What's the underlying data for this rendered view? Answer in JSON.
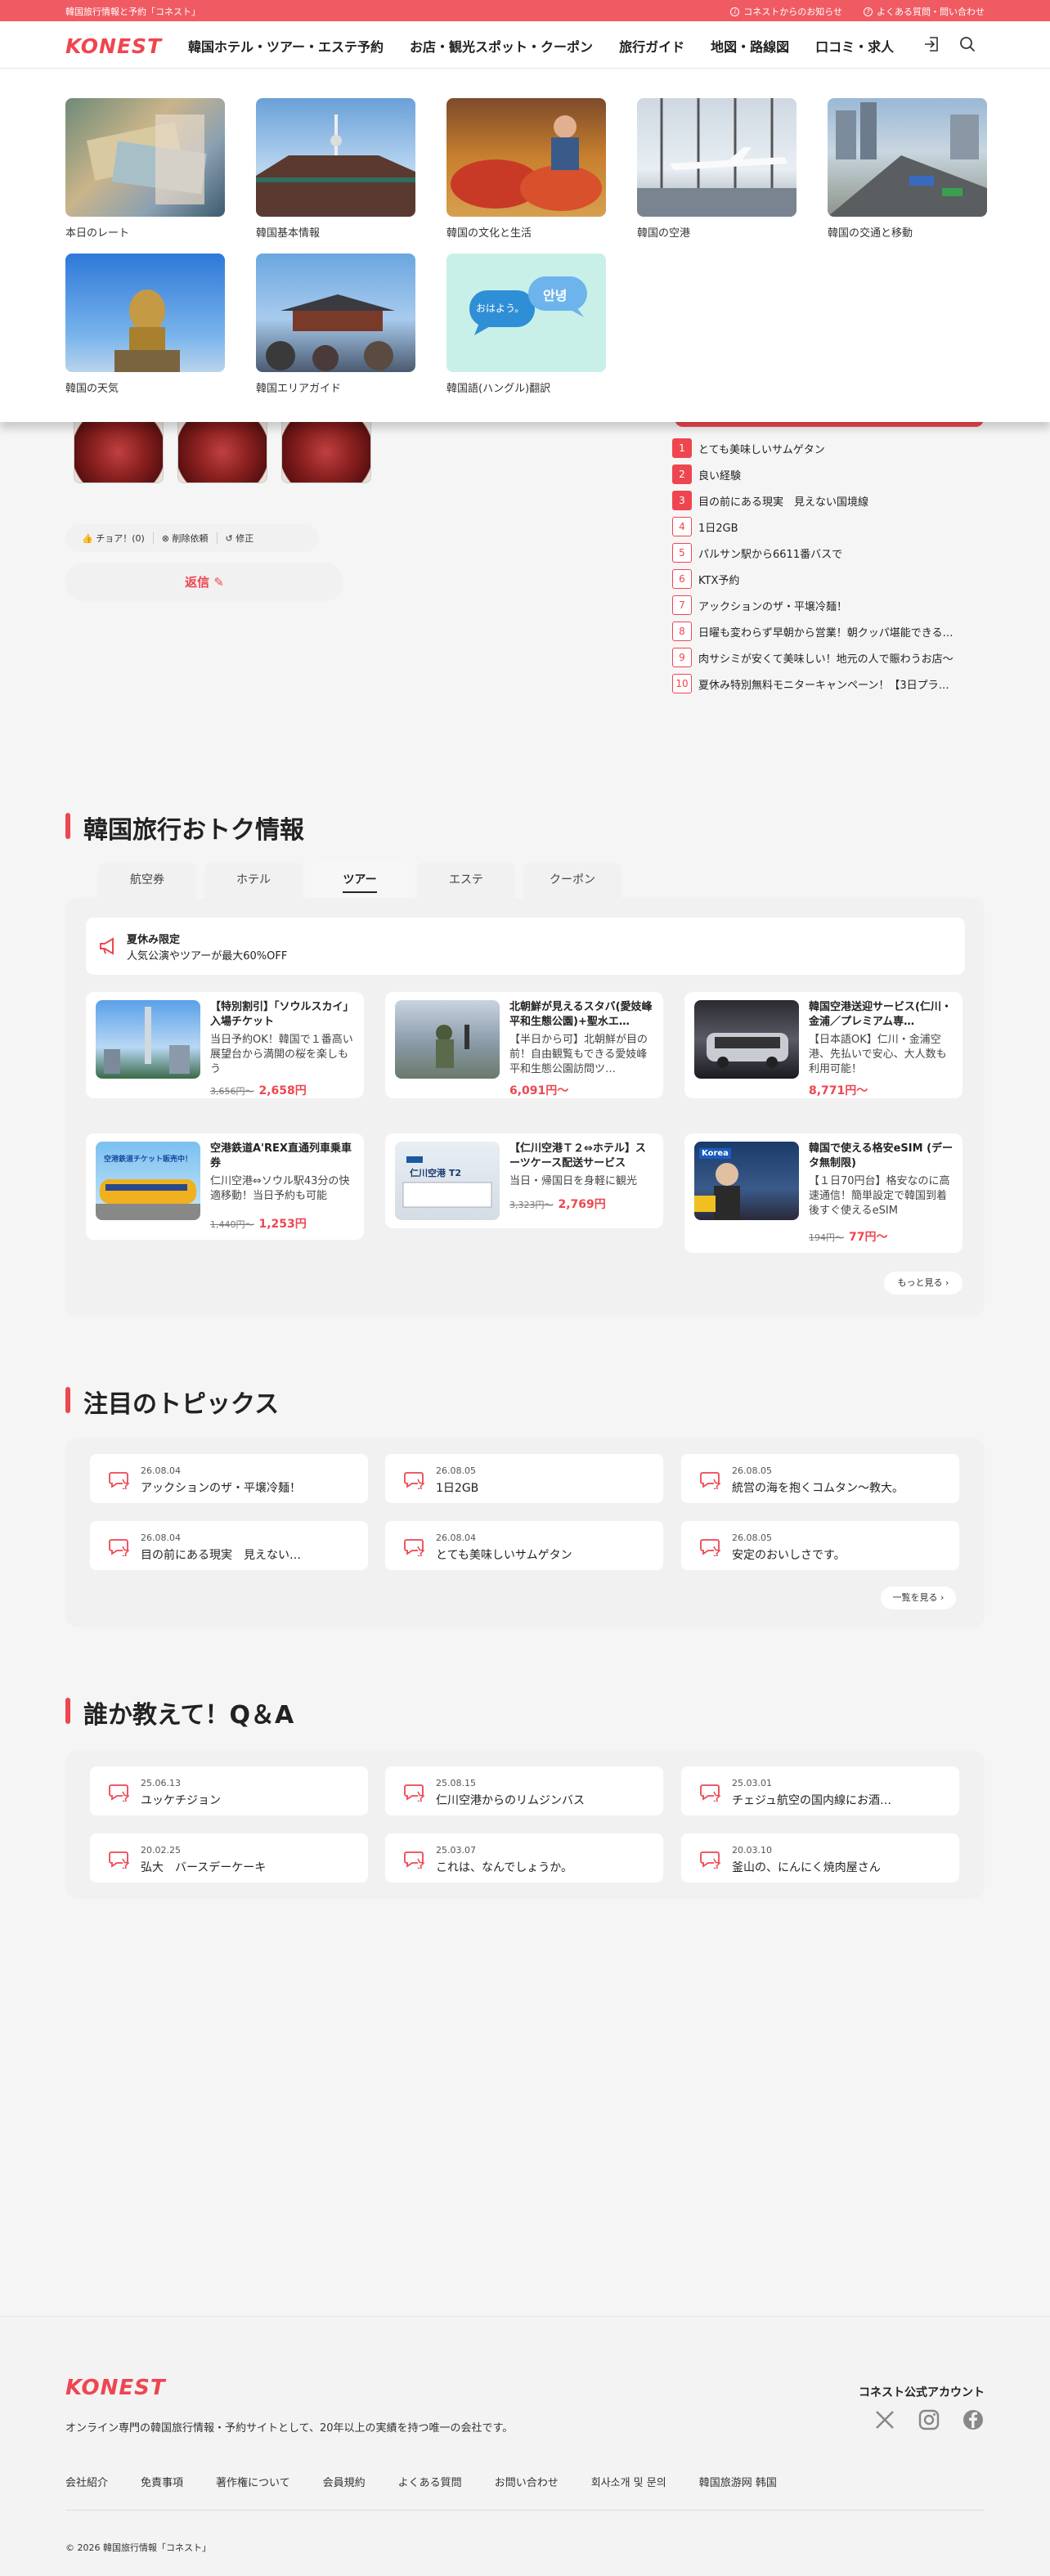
{
  "topbar": {
    "left_text": "韓国旅行情報と予約「コネスト」",
    "notice": "コネストからのお知らせ",
    "faq": "よくある質問・問い合わせ"
  },
  "header": {
    "logo": "KONEST",
    "nav": [
      "韓国ホテル・ツアー・エステ予約",
      "お店・観光スポット・クーポン",
      "旅行ガイド",
      "地図・路線図",
      "口コミ・求人"
    ]
  },
  "dropdown": {
    "items": [
      {
        "label": "本日のレート"
      },
      {
        "label": "韓国基本情報"
      },
      {
        "label": "韓国の文化と生活"
      },
      {
        "label": "韓国の空港"
      },
      {
        "label": "韓国の交通と移動"
      },
      {
        "label": "韓国の天気"
      },
      {
        "label": "韓国エリアガイド"
      },
      {
        "label": "韓国語(ハングル)翻訳"
      }
    ],
    "translate_bubbles": [
      "おはよう。",
      "안녕"
    ]
  },
  "post": {
    "cheer": "チョア！(0)",
    "delete_request": "削除依頼",
    "edit": "修正",
    "reply": "返信"
  },
  "ranking": [
    {
      "num": "1",
      "text": "とても美味しいサムゲタン"
    },
    {
      "num": "2",
      "text": "良い経験"
    },
    {
      "num": "3",
      "text": "目の前にある現実　見えない国境線"
    },
    {
      "num": "4",
      "text": "1日2GB"
    },
    {
      "num": "5",
      "text": "パルサン駅から6611番バスで"
    },
    {
      "num": "6",
      "text": "KTX予約"
    },
    {
      "num": "7",
      "text": "アックションのザ・平壌冷麺！"
    },
    {
      "num": "8",
      "text": "日曜も変わらず早朝から営業！朝クッパ堪能できる…"
    },
    {
      "num": "9",
      "text": "肉サシミが安くて美味しい！地元の人で賑わうお店～"
    },
    {
      "num": "10",
      "text": "夏休み特別無料モニターキャンペーン！【3日プラ…"
    }
  ],
  "deals": {
    "title": "韓国旅行おトク情報",
    "tabs": [
      "航空券",
      "ホテル",
      "ツアー",
      "エステ",
      "クーポン"
    ],
    "active_tab": "ツアー",
    "promo_tag": "夏休み限定",
    "promo_text": "人気公演やツアーが最大60%OFF",
    "products": [
      {
        "title": "【特別割引】「ソウルスカイ」入場チケット",
        "desc": "当日予約OK！韓国で１番高い展望台から満開の桜を楽しもう",
        "old": "3,656円～",
        "price": "2,658円"
      },
      {
        "title": "北朝鮮が見えるスタバ(愛妓峰平和生態公園)+聖水エ…",
        "desc": "【半日から可】北朝鮮が目の前！自由観覧もできる愛妓峰平和生態公園訪問ツ…",
        "old": "",
        "price": "6,091円～"
      },
      {
        "title": "韓国空港送迎サービス(仁川・金浦／プレミアム専…",
        "desc": "【日本語OK】仁川・金浦空港、先払いで安心、大人数も利用可能！",
        "old": "",
        "price": "8,771円～"
      },
      {
        "title": "空港鉄道A'REX直通列車乗車券",
        "desc": "仁川空港⇔ソウル駅43分の快適移動！当日予約も可能",
        "old": "1,440円～",
        "price": "1,253円"
      },
      {
        "title": "【仁川空港Ｔ２⇔ホテル】スーツケース配送サービス",
        "desc": "当日・帰国日を身軽に観光",
        "old": "3,323円～",
        "price": "2,769円"
      },
      {
        "title": "韓国で使える格安eSIM (データ無制限)",
        "desc": "【１日70円台】格安なのに高速通信！簡単設定で韓国到着後すぐ使えるeSIM",
        "old": "194円～",
        "price": "77円～"
      }
    ],
    "img_texts": [
      "空港鉄道チケット販売中！",
      "仁川空港 T2",
      "Korea"
    ],
    "more": "もっと見る"
  },
  "topics": {
    "title": "注目のトピックス",
    "items": [
      {
        "date": "26.08.04",
        "text": "アックションのザ・平壌冷麺！"
      },
      {
        "date": "26.08.05",
        "text": "1日2GB"
      },
      {
        "date": "26.08.05",
        "text": "統営の海を抱くコムタン〜教大。"
      },
      {
        "date": "26.08.04",
        "text": "目の前にある現実　見えない…"
      },
      {
        "date": "26.08.04",
        "text": "とても美味しいサムゲタン"
      },
      {
        "date": "26.08.05",
        "text": "安定のおいしさです。"
      }
    ],
    "more": "一覧を見る"
  },
  "qa": {
    "title": "誰か教えて！Q＆A",
    "items": [
      {
        "date": "25.06.13",
        "text": "ユッケチジョン"
      },
      {
        "date": "25.08.15",
        "text": "仁川空港からのリムジンバス"
      },
      {
        "date": "25.03.01",
        "text": "チェジュ航空の国内線にお酒…"
      },
      {
        "date": "20.02.25",
        "text": "弘大　バースデーケーキ"
      },
      {
        "date": "25.03.07",
        "text": "これは、なんでしょうか。"
      },
      {
        "date": "20.03.10",
        "text": "釜山の、にんにく焼肉屋さん"
      }
    ]
  },
  "footer": {
    "logo": "KONEST",
    "description": "オンライン専門の韓国旅行情報・予約サイトとして、20年以上の実績を持つ唯一の会社です。",
    "account_title": "コネスト公式アカウント",
    "links": [
      "会社紹介",
      "免責事項",
      "著作権について",
      "会員規約",
      "よくある質問",
      "お問い合わせ",
      "회사소개 및 문의",
      "韓国旅游网 韩国"
    ],
    "copyright": "© 2026 韓国旅行情報「コネスト」"
  },
  "colors": {
    "accent": "#ee4650",
    "topbar": "#f05b63"
  }
}
